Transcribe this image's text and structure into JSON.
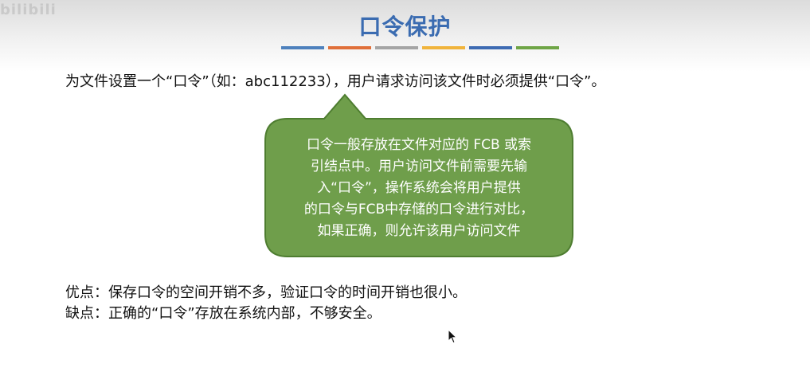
{
  "watermark": "bilibili",
  "slide": {
    "title": "口令保护",
    "title_bar_colors": [
      "#4e81bd",
      "#e0703a",
      "#a5a5a5",
      "#f0b43c",
      "#3e6bb3",
      "#6fa546"
    ],
    "statement": "为文件设置一个“口令”（如：abc112233），用户请求访问该文件时必须提供“口令”。",
    "callout": {
      "lines": [
        "口令一般存放在文件对应的 FCB 或索",
        "引结点中。用户访问文件前需要先输",
        "入“口令”，操作系统会将用户提供",
        "的口令与FCB中存储的口令进行对比，",
        "如果正确，则允许该用户访问文件"
      ],
      "fill_color": "#6f9e4b",
      "border_color": "#4e7d30"
    },
    "pros": "优点：保存口令的空间开销不多，验证口令的时间开销也很小。",
    "cons": "缺点：正确的“口令”存放在系统内部，不够安全。"
  }
}
